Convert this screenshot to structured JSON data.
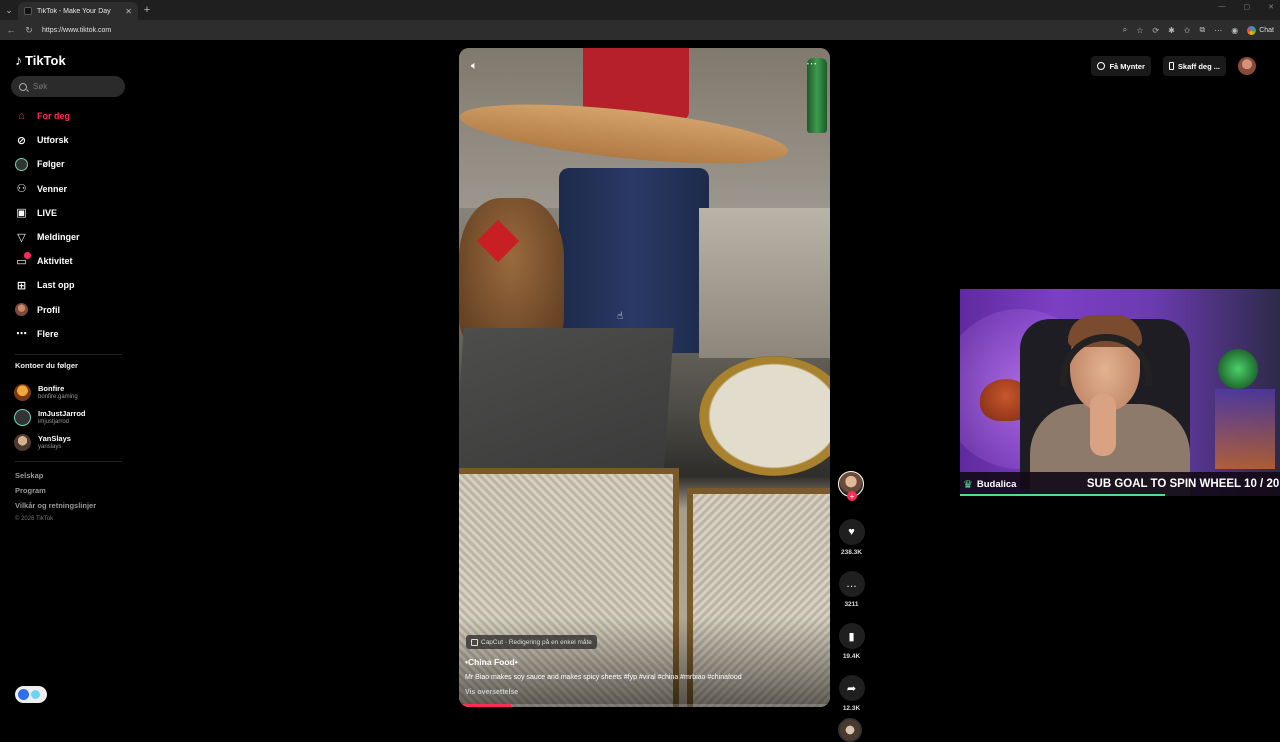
{
  "browser": {
    "tab_title": "TikTok - Make Your Day",
    "url": "https://www.tiktok.com",
    "chat_label": "Chat"
  },
  "sidebar": {
    "logo": "TikTok",
    "search_placeholder": "Søk",
    "nav": [
      {
        "label": "For deg",
        "icon": "home-icon",
        "active": true
      },
      {
        "label": "Utforsk",
        "icon": "compass-icon"
      },
      {
        "label": "Følger",
        "icon": "following-avatar-icon"
      },
      {
        "label": "Venner",
        "icon": "friends-icon"
      },
      {
        "label": "LIVE",
        "icon": "live-icon"
      },
      {
        "label": "Meldinger",
        "icon": "messages-icon"
      },
      {
        "label": "Aktivitet",
        "icon": "activity-icon",
        "badge": true
      },
      {
        "label": "Last opp",
        "icon": "upload-icon"
      },
      {
        "label": "Profil",
        "icon": "profile-avatar-icon"
      },
      {
        "label": "Flere",
        "icon": "more-icon"
      }
    ],
    "following_title": "Kontoer du følger",
    "following": [
      {
        "name": "Bonfire",
        "handle": "bonfire.gaming"
      },
      {
        "name": "ImJustJarrod",
        "handle": "imjustjarrod"
      },
      {
        "name": "YanSlays",
        "handle": "yanslays"
      }
    ],
    "footer": {
      "links": [
        "Selskap",
        "Program",
        "Vilkår og retningslinjer"
      ],
      "copyright": "© 2026 TikTok"
    }
  },
  "video": {
    "capcut_label": "CapCut · Redigering på en enkel måte",
    "author": "•China Food•",
    "caption": "Mr Biao makes soy sauce and makes spicy sheets #fyp #viral #china #mrbiao #chinafood",
    "translate_label": "Vis oversettelse",
    "progress": 0.14
  },
  "actions": {
    "likes": "238.3K",
    "comments": "3211",
    "saves": "19.4K",
    "shares": "12.3K"
  },
  "topbar": {
    "coins_label": "Få Mynter",
    "app_label": "Skaff deg ..."
  },
  "stream_overlay": {
    "streamer": "Budalica",
    "goal_text": "SUB GOAL TO SPIN WHEEL 10 / 20"
  },
  "colors": {
    "accent": "#fe2c55",
    "background": "#000000",
    "overlay_accent": "#4be08a"
  }
}
